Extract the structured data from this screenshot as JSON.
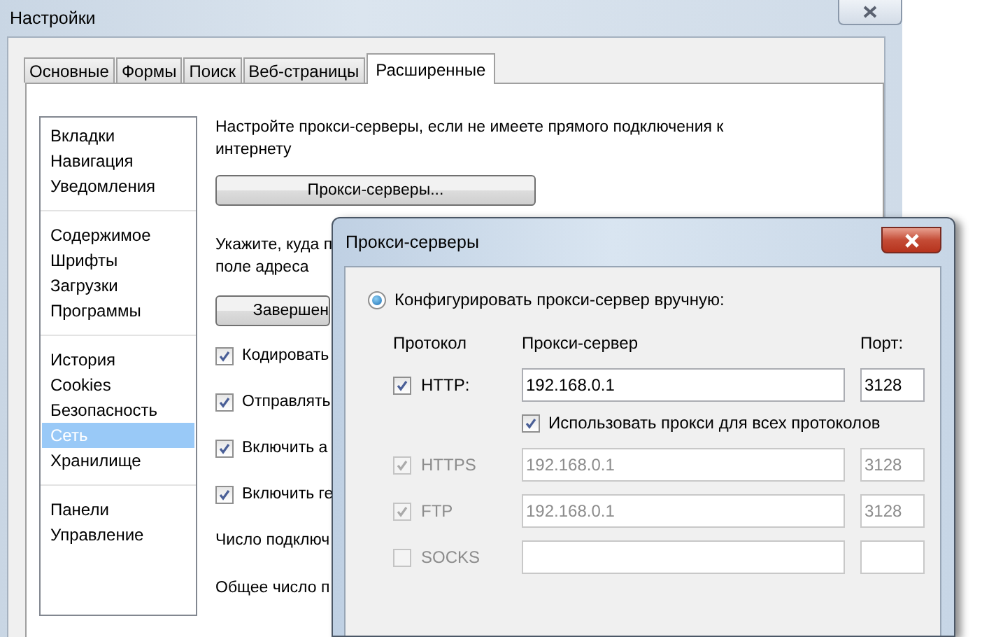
{
  "window": {
    "title": "Настройки"
  },
  "tabs": [
    {
      "label": "Основные",
      "selected": false
    },
    {
      "label": "Формы",
      "selected": false
    },
    {
      "label": "Поиск",
      "selected": false
    },
    {
      "label": "Веб-страницы",
      "selected": false
    },
    {
      "label": "Расширенные",
      "selected": true
    }
  ],
  "sidebar": {
    "groups": [
      {
        "items": [
          {
            "label": "Вкладки",
            "selected": false
          },
          {
            "label": "Навигация",
            "selected": false
          },
          {
            "label": "Уведомления",
            "selected": false
          }
        ]
      },
      {
        "items": [
          {
            "label": "Содержимое",
            "selected": false
          },
          {
            "label": "Шрифты",
            "selected": false
          },
          {
            "label": "Загрузки",
            "selected": false
          },
          {
            "label": "Программы",
            "selected": false
          }
        ]
      },
      {
        "items": [
          {
            "label": "История",
            "selected": false
          },
          {
            "label": "Cookies",
            "selected": false
          },
          {
            "label": "Безопасность",
            "selected": false
          },
          {
            "label": "Сеть",
            "selected": true
          },
          {
            "label": "Хранилище",
            "selected": false
          }
        ]
      },
      {
        "items": [
          {
            "label": "Панели",
            "selected": false
          },
          {
            "label": "Управление",
            "selected": false
          }
        ]
      }
    ]
  },
  "content": {
    "proxy_text": "Настройте прокси-серверы, если не имеете прямого подключения к интернету",
    "proxy_button": "Прокси-серверы...",
    "address_text": [
      "Укажите, куда п",
      "поле адреса"
    ],
    "finish_button": "Завершен",
    "checkboxes": [
      {
        "label": "Кодировать",
        "checked": true
      },
      {
        "label": "Отправлять",
        "checked": true
      },
      {
        "label": "Включить а",
        "checked": true
      },
      {
        "label": "Включить ге",
        "checked": true
      }
    ],
    "labels": [
      "Число подключ",
      "Общее число п"
    ]
  },
  "dialog": {
    "title": "Прокси-серверы",
    "manual": {
      "label": "Конфигурировать прокси-сервер вручную:",
      "selected": true
    },
    "columns": [
      "Протокол",
      "Прокси-сервер",
      "Порт:"
    ],
    "rows": [
      {
        "protocol": "HTTP:",
        "checked": true,
        "disabled": false,
        "host": "192.168.0.1",
        "port": "3128"
      },
      {
        "protocol": "HTTPS",
        "checked": true,
        "disabled": true,
        "host": "192.168.0.1",
        "port": "3128"
      },
      {
        "protocol": "FTP",
        "checked": true,
        "disabled": true,
        "host": "192.168.0.1",
        "port": "3128"
      },
      {
        "protocol": "SOCKS",
        "checked": false,
        "disabled": true
      }
    ],
    "use_for_all": {
      "label": "Использовать прокси для всех протоколов",
      "checked": true
    }
  }
}
